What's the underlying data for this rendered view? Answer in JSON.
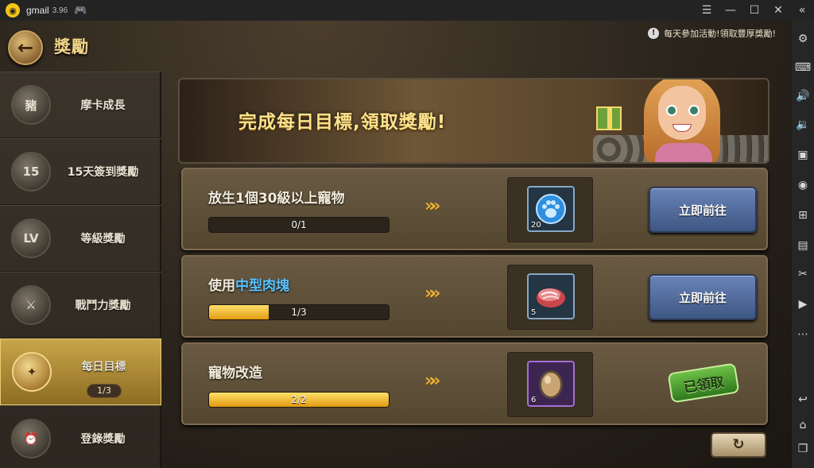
{
  "emulator": {
    "title": "gmail",
    "version": "3.96",
    "toolbar_icons": [
      "settings-icon",
      "keyboard-icon",
      "volume-up-icon",
      "volume-down-icon",
      "screenshot-icon",
      "record-icon",
      "add-app-icon",
      "apk-icon",
      "scissors-icon",
      "video-icon",
      "more-icon",
      "back-icon",
      "home-icon",
      "recent-apps-icon"
    ]
  },
  "header": {
    "title": "獎勵",
    "notice": "每天參加活動!領取豐厚獎勵!"
  },
  "nav": {
    "items": [
      {
        "label": "摩卡成長",
        "icon": "pig-icon",
        "glyph": "豬"
      },
      {
        "label": "15天簽到獎勵",
        "icon": "calendar-15-icon",
        "glyph": "15"
      },
      {
        "label": "等級獎勵",
        "icon": "level-up-icon",
        "glyph": "LV"
      },
      {
        "label": "戰鬥力獎勵",
        "icon": "crossed-swords-icon",
        "glyph": "⚔"
      },
      {
        "label": "每日目標",
        "icon": "daily-goal-icon",
        "glyph": "✦",
        "badge": "1/3"
      },
      {
        "label": "登錄獎勵",
        "icon": "alarm-clock-icon",
        "glyph": "⏰"
      }
    ]
  },
  "banner": {
    "text": "完成每日目標,領取獎勵!"
  },
  "tasks": [
    {
      "title": "放生1個30級以上寵物",
      "title_highlight": "",
      "progress_text": "0/1",
      "progress": 0.0,
      "item_icon": "blue-paw-token-icon",
      "item_count": "20",
      "action": "立即前往",
      "claimed": false
    },
    {
      "title": "使用",
      "title_highlight": "中型肉塊",
      "progress_text": "1/3",
      "progress": 0.333,
      "item_icon": "meat-icon",
      "item_count": "5",
      "action": "立即前往",
      "claimed": false
    },
    {
      "title": "寵物改造",
      "title_highlight": "",
      "progress_text": "2/2",
      "progress": 1.0,
      "item_icon": "egg-icon",
      "item_count": "6",
      "action": "已領取",
      "claimed": true
    }
  ],
  "colors": {
    "accent_gold": "#f3d58a",
    "highlight_blue": "#5ac3ff",
    "goto_button": "#4e6aa0",
    "claimed_green": "#4a9a30"
  }
}
